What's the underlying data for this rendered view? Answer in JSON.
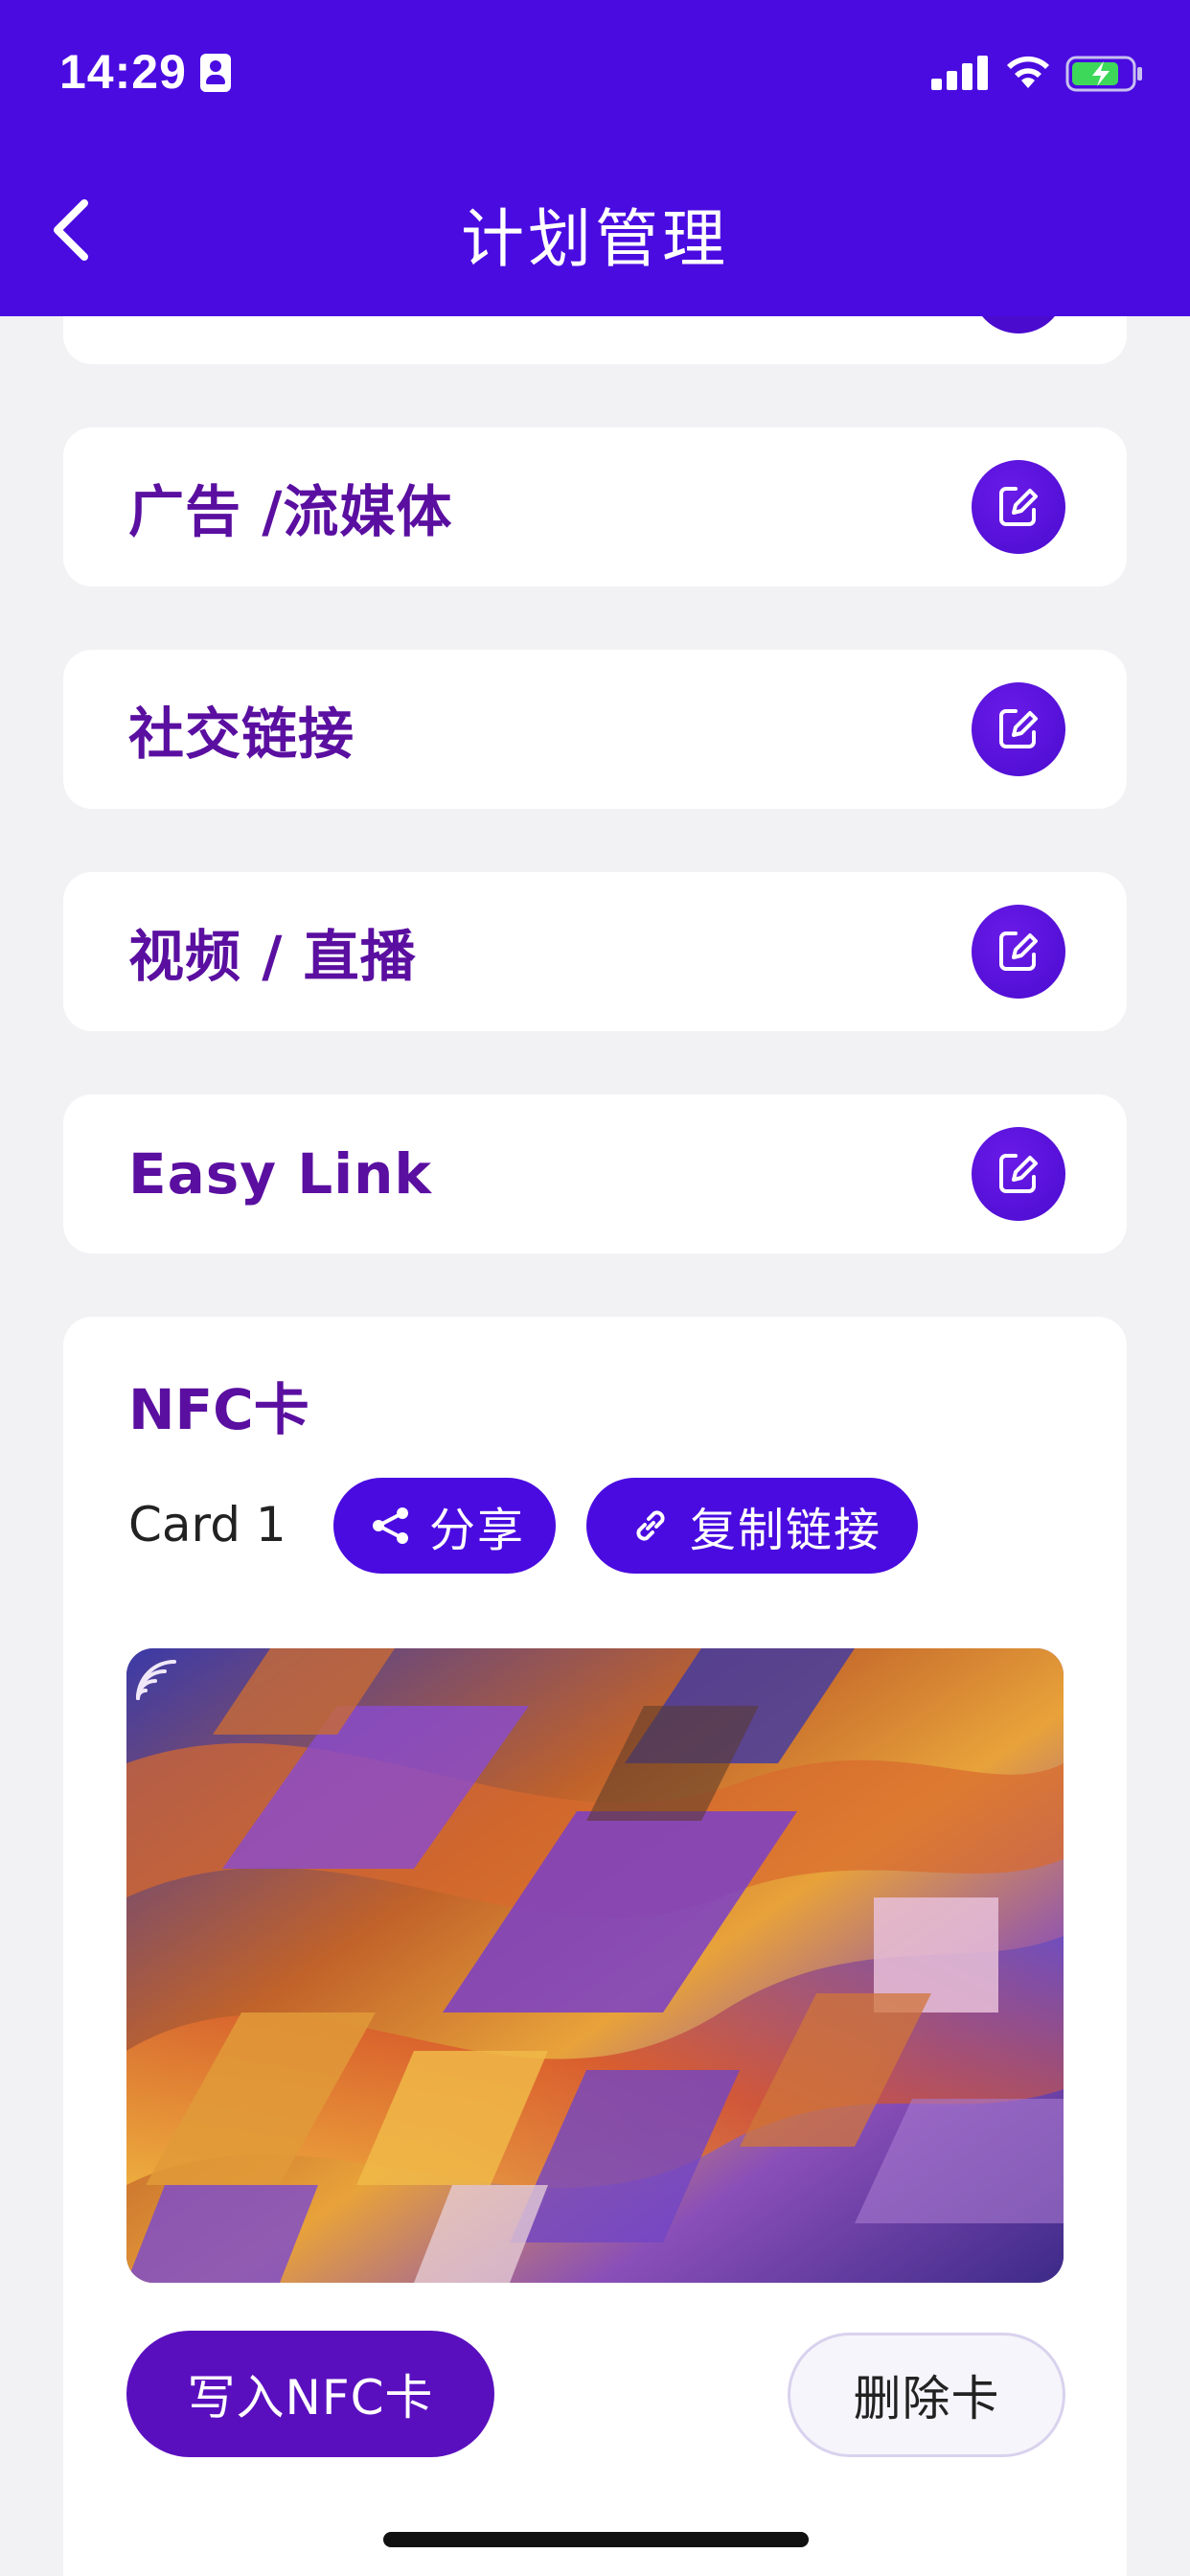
{
  "status_bar": {
    "time": "14:29"
  },
  "header": {
    "title": "计划管理"
  },
  "sections": [
    {
      "label": "广告 /流媒体"
    },
    {
      "label": "社交链接"
    },
    {
      "label": "视频 / 直播"
    },
    {
      "label": "Easy Link"
    }
  ],
  "nfc": {
    "title": "NFC卡",
    "card_name": "Card 1",
    "share_label": "分享",
    "copy_label": "复制链接",
    "write_label": "写入NFC卡",
    "delete_label": "删除卡"
  },
  "colors": {
    "brand": "#4a0be0",
    "label": "#5a0fa0",
    "background": "#f2f1f4"
  },
  "icons": {
    "back": "chevron-left-icon",
    "edit": "edit-icon",
    "share": "share-icon",
    "link": "link-icon",
    "nfc": "nfc-wave-icon"
  }
}
